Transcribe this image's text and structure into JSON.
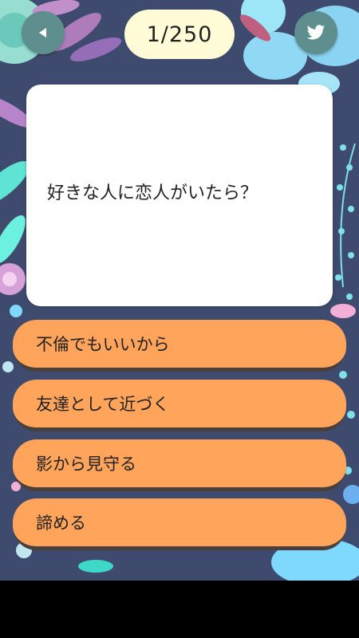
{
  "header": {
    "back_icon": "back-arrow-icon",
    "share_icon": "twitter-bird-icon",
    "counter": "1/250"
  },
  "question": {
    "text": "好きな人に恋人がいたら？"
  },
  "answers": [
    {
      "label": "不倫でもいいから"
    },
    {
      "label": "友達として近づく"
    },
    {
      "label": "影から見守る"
    },
    {
      "label": "諦める"
    }
  ],
  "colors": {
    "background": "#3f4b6e",
    "icon_button": "#5e8f8e",
    "counter_pill": "#fffbd6",
    "answer_button": "#ffa45a",
    "answer_shadow": "#4a3f3a",
    "card": "#ffffff"
  }
}
